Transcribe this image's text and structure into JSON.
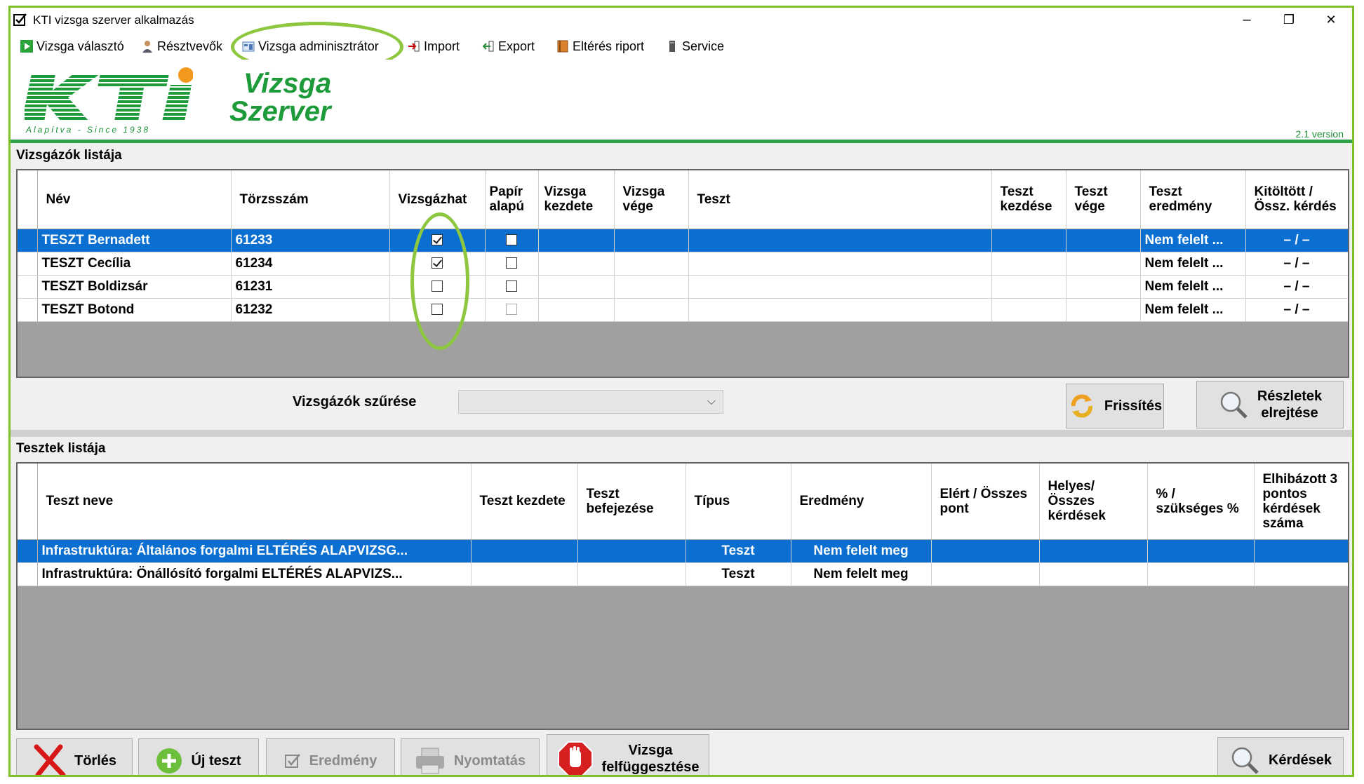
{
  "window": {
    "title": "KTI vizsga szerver alkalmazás",
    "minimize": "–",
    "maximize": "❐",
    "close": "✕"
  },
  "menu": [
    {
      "label": "Vizsga választó",
      "icon": "play-icon"
    },
    {
      "label": "Résztvevők",
      "icon": "user-icon"
    },
    {
      "label": "Vizsga adminisztrátor",
      "icon": "admin-icon"
    },
    {
      "label": "Import",
      "icon": "import-icon"
    },
    {
      "label": "Export",
      "icon": "export-icon"
    },
    {
      "label": "Eltérés riport",
      "icon": "book-icon"
    },
    {
      "label": "Service",
      "icon": "server-icon"
    }
  ],
  "header": {
    "logo_text": "KTI",
    "logo_since": "Alapítva - Since 1938",
    "app_name_1": "Vizsga",
    "app_name_2": "Szerver",
    "version": "2.1 version",
    "brand_color": "#1d9a3a"
  },
  "examinees": {
    "title": "Vizsgázók listája",
    "columns": [
      "Név",
      "Törzsszám",
      "Vizsgázhat",
      "Papír alapú",
      "Vizsga kezdete",
      "Vizsga vége",
      "Teszt",
      "Teszt kezdése",
      "Teszt vége",
      "Teszt eredmény",
      "Kitöltött / Össz. kérdés"
    ],
    "rows": [
      {
        "name": "TESZT Bernadett",
        "id": "61233",
        "can_exam": true,
        "paper": false,
        "exam_start": "",
        "exam_end": "",
        "test": "",
        "test_start": "",
        "test_end": "",
        "result": "Nem felelt ...",
        "filled": "– / –",
        "selected": true
      },
      {
        "name": "TESZT Cecília",
        "id": "61234",
        "can_exam": true,
        "paper": false,
        "exam_start": "",
        "exam_end": "",
        "test": "",
        "test_start": "",
        "test_end": "",
        "result": "Nem felelt ...",
        "filled": "– / –",
        "selected": false
      },
      {
        "name": "TESZT Boldizsár",
        "id": "61231",
        "can_exam": false,
        "paper": false,
        "exam_start": "",
        "exam_end": "",
        "test": "",
        "test_start": "",
        "test_end": "",
        "result": "Nem felelt ...",
        "filled": "– / –",
        "selected": false
      },
      {
        "name": "TESZT Botond",
        "id": "61232",
        "can_exam": false,
        "paper": false,
        "exam_start": "",
        "exam_end": "",
        "test": "",
        "test_start": "",
        "test_end": "",
        "result": "Nem felelt ...",
        "filled": "– / –",
        "selected": false
      }
    ]
  },
  "filter": {
    "label": "Vizsgázók szűrése",
    "value": ""
  },
  "buttons_mid": {
    "refresh": "Frissítés",
    "hide_details_1": "Részletek",
    "hide_details_2": "elrejtése"
  },
  "tests": {
    "title": "Tesztek listája",
    "columns": [
      "Teszt neve",
      "Teszt kezdete",
      "Teszt befejezése",
      "Típus",
      "Eredmény",
      "Elért / Összes pont",
      "Helyes/ Összes kérdések",
      "% / szükséges %",
      "Elhibázott 3 pontos kérdések száma"
    ],
    "rows": [
      {
        "name": "Infrastruktúra: Általános forgalmi ELTÉRÉS ALAPVIZSG...",
        "start": "",
        "end": "",
        "type": "Teszt",
        "result": "Nem felelt meg",
        "points": "",
        "correct": "",
        "percent": "",
        "missed": "",
        "selected": true
      },
      {
        "name": "Infrastruktúra: Önállósító forgalmi ELTÉRÉS ALAPVIZS...",
        "start": "",
        "end": "",
        "type": "Teszt",
        "result": "Nem felelt meg",
        "points": "",
        "correct": "",
        "percent": "",
        "missed": "",
        "selected": false
      }
    ]
  },
  "buttons_bottom": {
    "delete": "Törlés",
    "new_test": "Új teszt",
    "result": "Eredmény",
    "print": "Nyomtatás",
    "suspend_1": "Vizsga",
    "suspend_2": "felfüggesztése",
    "questions": "Kérdések"
  },
  "colors": {
    "selection": "#0a6fd0",
    "highlight_ring": "#8dc63f",
    "frame": "#7fbf2a"
  }
}
